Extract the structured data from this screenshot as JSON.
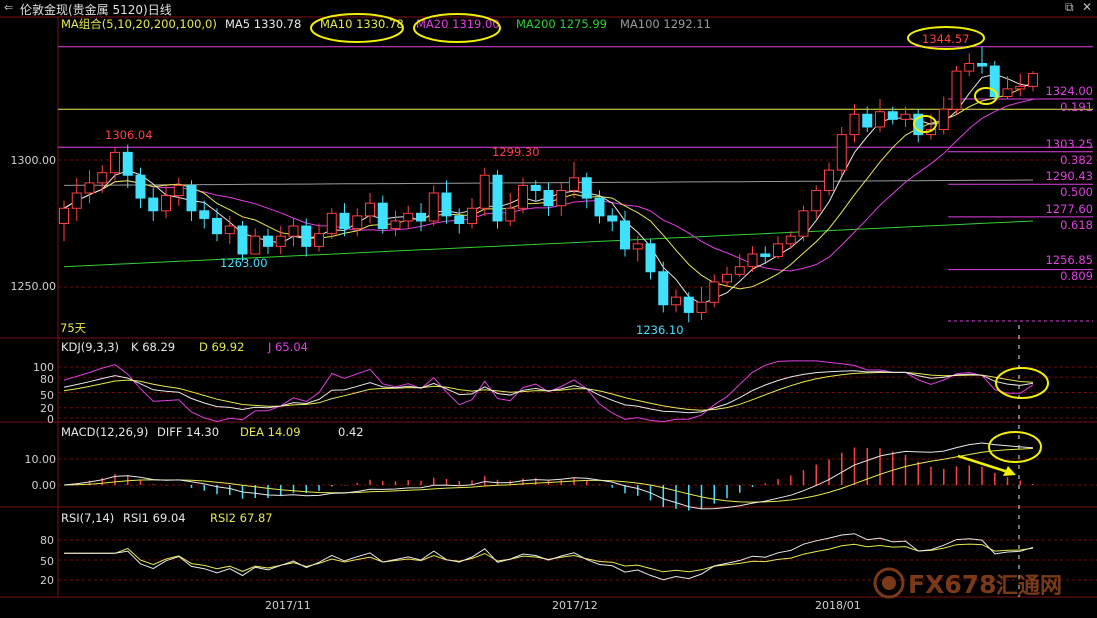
{
  "window": {
    "title": "伦敦金现(贵金属 5120)日线",
    "back_icon": "back-arrow-icon",
    "restore_icon": "restore-icon",
    "close_icon": "close-icon"
  },
  "ma_legend": {
    "group": "MA组合(5,10,20,200,100,0)",
    "ma5": "MA5 1330.78",
    "ma10": "MA10 1330.78",
    "ma20": "MA20 1319.00",
    "ma200": "MA200 1275.99",
    "ma100": "MA100 1292.11"
  },
  "colors": {
    "up": "#ff4040",
    "down": "#40e0ff",
    "ma5": "#e8e8e8",
    "ma10": "#e8e850",
    "ma20": "#e040e0",
    "ma200": "#30d030",
    "ma100": "#9a9a9a",
    "fib": "#e040e0",
    "highlight": "#f0f000"
  },
  "price_panel": {
    "y_ticks": [
      "1300.00",
      "1250.00"
    ],
    "annotations": {
      "high_1": "1306.04",
      "low_1": "1263.00",
      "high_2": "1299.30",
      "low_2": "1236.10",
      "high_3": "1344.57"
    },
    "fib_levels": [
      {
        "price": "1324.00",
        "ratio": "0.191"
      },
      {
        "price": "1303.25",
        "ratio": "0.382"
      },
      {
        "price": "1290.43",
        "ratio": "0.500"
      },
      {
        "price": "1277.60",
        "ratio": "0.618"
      },
      {
        "price": "1256.85",
        "ratio": "0.809"
      }
    ],
    "period_label": "75天"
  },
  "kdj": {
    "header": "KDJ(9,3,3)",
    "k": "K  68.29",
    "d": "D  69.92",
    "j": "J  65.04",
    "y_ticks": [
      "100",
      "80",
      "50",
      "20",
      "0"
    ]
  },
  "macd": {
    "header": "MACD(12,26,9)",
    "diff": "DIFF  14.30",
    "dea": "DEA  14.09",
    "macd": "0.42",
    "y_ticks": [
      "10.00",
      "0.00"
    ]
  },
  "rsi": {
    "header": "RSI(7,14)",
    "rsi1": "RSI1  69.04",
    "rsi2": "RSI2  67.87",
    "y_ticks": [
      "80",
      "50",
      "20"
    ]
  },
  "x_axis": {
    "labels": [
      "2017/11",
      "2017/12",
      "2018/01"
    ]
  },
  "watermark": {
    "brand": "FX678",
    "brand_cn": "汇通网"
  },
  "chart_data": {
    "type": "candlestick",
    "title": "伦敦金现(贵金属 5120)日线",
    "x_labels": [
      "2017/11",
      "2017/12",
      "2018/01"
    ],
    "ylim": [
      1225,
      1355
    ],
    "candles": [
      [
        1275,
        1281,
        1268,
        1284
      ],
      [
        1281,
        1287,
        1276,
        1293
      ],
      [
        1287,
        1291,
        1283,
        1296
      ],
      [
        1291,
        1295,
        1287,
        1298
      ],
      [
        1295,
        1303,
        1292,
        1305
      ],
      [
        1303,
        1294,
        1289,
        1306.04
      ],
      [
        1294,
        1285,
        1281,
        1297
      ],
      [
        1285,
        1280,
        1276,
        1289
      ],
      [
        1280,
        1286,
        1277,
        1290
      ],
      [
        1286,
        1290,
        1282,
        1293
      ],
      [
        1290,
        1280,
        1276,
        1292
      ],
      [
        1280,
        1277,
        1273,
        1284
      ],
      [
        1277,
        1271,
        1268,
        1281
      ],
      [
        1271,
        1274,
        1267,
        1278
      ],
      [
        1274,
        1263,
        1260,
        1276
      ],
      [
        1263,
        1270,
        1263,
        1273
      ],
      [
        1270,
        1266,
        1263,
        1273
      ],
      [
        1266,
        1270,
        1263,
        1274
      ],
      [
        1270,
        1274,
        1266,
        1277
      ],
      [
        1274,
        1266,
        1262,
        1277
      ],
      [
        1266,
        1271,
        1264,
        1275
      ],
      [
        1271,
        1279,
        1269,
        1281
      ],
      [
        1279,
        1273,
        1270,
        1283
      ],
      [
        1273,
        1278,
        1270,
        1281
      ],
      [
        1278,
        1283,
        1275,
        1287
      ],
      [
        1283,
        1273,
        1271,
        1286
      ],
      [
        1273,
        1276,
        1270,
        1280
      ],
      [
        1276,
        1279,
        1273,
        1282
      ],
      [
        1279,
        1276,
        1272,
        1283
      ],
      [
        1276,
        1287,
        1274,
        1290
      ],
      [
        1287,
        1278,
        1275,
        1292
      ],
      [
        1278,
        1275,
        1271,
        1281
      ],
      [
        1275,
        1281,
        1273,
        1285
      ],
      [
        1281,
        1294,
        1278,
        1297
      ],
      [
        1294,
        1276,
        1273,
        1296
      ],
      [
        1276,
        1281,
        1274,
        1287
      ],
      [
        1281,
        1290,
        1279,
        1293
      ],
      [
        1290,
        1288,
        1284,
        1292
      ],
      [
        1288,
        1282,
        1278,
        1291
      ],
      [
        1282,
        1288,
        1278,
        1291
      ],
      [
        1288,
        1293,
        1285,
        1299.3
      ],
      [
        1293,
        1285,
        1281,
        1295
      ],
      [
        1285,
        1278,
        1275,
        1288
      ],
      [
        1278,
        1276,
        1272,
        1281
      ],
      [
        1276,
        1265,
        1262,
        1280
      ],
      [
        1265,
        1267,
        1260,
        1270
      ],
      [
        1267,
        1256,
        1253,
        1269
      ],
      [
        1256,
        1243,
        1240,
        1260
      ],
      [
        1243,
        1246,
        1240,
        1249
      ],
      [
        1246,
        1240,
        1236.1,
        1248
      ],
      [
        1240,
        1244,
        1237,
        1250
      ],
      [
        1244,
        1252,
        1242,
        1255
      ],
      [
        1252,
        1255,
        1250,
        1258
      ],
      [
        1255,
        1258,
        1254,
        1263
      ],
      [
        1258,
        1263,
        1256,
        1266
      ],
      [
        1263,
        1262,
        1259,
        1266
      ],
      [
        1262,
        1267,
        1261,
        1270
      ],
      [
        1267,
        1270,
        1265,
        1272
      ],
      [
        1270,
        1280,
        1268,
        1282
      ],
      [
        1280,
        1288,
        1277,
        1290
      ],
      [
        1288,
        1296,
        1286,
        1299
      ],
      [
        1296,
        1310,
        1294,
        1313
      ],
      [
        1310,
        1318,
        1307,
        1322
      ],
      [
        1318,
        1313,
        1311,
        1321
      ],
      [
        1313,
        1319,
        1311,
        1324
      ],
      [
        1319,
        1316,
        1314,
        1321
      ],
      [
        1316,
        1318,
        1313,
        1321
      ],
      [
        1318,
        1310,
        1307,
        1320
      ],
      [
        1310,
        1312,
        1308,
        1318
      ],
      [
        1312,
        1320,
        1310,
        1325
      ],
      [
        1320,
        1335,
        1318,
        1337
      ],
      [
        1335,
        1338,
        1333,
        1342
      ],
      [
        1338,
        1337,
        1334,
        1344.57
      ],
      [
        1337,
        1325,
        1323,
        1339
      ],
      [
        1325,
        1328,
        1324,
        1333
      ],
      [
        1328,
        1329,
        1325,
        1334
      ],
      [
        1329,
        1334,
        1327,
        1335
      ]
    ],
    "fib_levels": [
      {
        "ratio": 0.191,
        "price": 1324.0
      },
      {
        "ratio": 0.382,
        "price": 1303.25
      },
      {
        "ratio": 0.5,
        "price": 1290.43
      },
      {
        "ratio": 0.618,
        "price": 1277.6
      },
      {
        "ratio": 0.809,
        "price": 1256.85
      }
    ],
    "highlight_levels": [
      1344.57,
      1331
    ],
    "ma_last": {
      "MA5": 1330.78,
      "MA10": 1330.78,
      "MA20": 1319.0,
      "MA200": 1275.99,
      "MA100": 1292.11
    },
    "kdj_last": {
      "K": 68.29,
      "D": 69.92,
      "J": 65.04
    },
    "macd_last": {
      "DIFF": 14.3,
      "DEA": 14.09,
      "MACD": 0.42
    },
    "rsi_last": {
      "RSI1": 69.04,
      "RSI2": 67.87
    },
    "kdj_ylim": [
      -10,
      115
    ],
    "macd_ylim": [
      -16,
      22
    ],
    "rsi_ylim": [
      10,
      95
    ]
  }
}
